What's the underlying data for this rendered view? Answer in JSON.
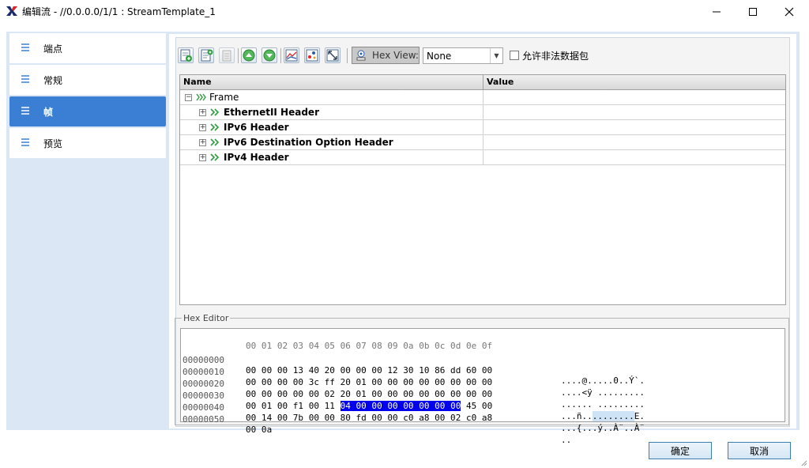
{
  "window": {
    "title": "编辑流 - //0.0.0.0/1/1 : StreamTemplate_1",
    "logo": "x-logo-icon",
    "controls": [
      "minimize-icon",
      "maximize-icon",
      "close-icon"
    ]
  },
  "sidebar": {
    "items": [
      {
        "label": "端点",
        "icon": "list-icon",
        "active": false
      },
      {
        "label": "常规",
        "icon": "list-icon",
        "active": false
      },
      {
        "label": "帧",
        "icon": "list-icon",
        "active": true
      },
      {
        "label": "预览",
        "icon": "list-icon",
        "active": false
      }
    ]
  },
  "toolbar": {
    "icons": [
      "add-doc-icon",
      "insert-doc-icon",
      "paste-doc-icon",
      "move-up-icon",
      "move-down-icon",
      "chart-icon",
      "dots-icon",
      "resize-icon"
    ],
    "hex_view_label": "Hex View:",
    "hex_view_value": "None",
    "allow_illegal_label": "允许非法数据包",
    "allow_illegal_checked": false
  },
  "tree": {
    "headers": {
      "name": "Name",
      "value": "Value"
    },
    "rows": [
      {
        "label": "Frame",
        "value": "",
        "bold": false,
        "expander": "−"
      },
      {
        "label": "EthernetII Header",
        "value": "",
        "bold": true,
        "expander": "+"
      },
      {
        "label": "IPv6 Header",
        "value": "",
        "bold": true,
        "expander": "+"
      },
      {
        "label": "IPv6 Destination Option Header",
        "value": "",
        "bold": true,
        "expander": "+"
      },
      {
        "label": "IPv4 Header",
        "value": "",
        "bold": true,
        "expander": "+"
      }
    ]
  },
  "hex_editor": {
    "title": "Hex Editor",
    "header": "00 01 02 03 04 05 06 07 08 09 0a 0b 0c 0d 0e 0f",
    "lines": [
      {
        "addr": "00000000",
        "pre": "00 00 00 13 40 20 00 00 00 12 30 10 86 dd 60 00",
        "sel": "",
        "post": "",
        "ascii_pre": "....@.....0..Ý`.",
        "ascii_sel": "",
        "ascii_post": ""
      },
      {
        "addr": "00000010",
        "pre": "00 00 00 00 3c ff 20 01 00 00 00 00 00 00 00 00",
        "sel": "",
        "post": "",
        "ascii_pre": "....<ÿ .........",
        "ascii_sel": "",
        "ascii_post": ""
      },
      {
        "addr": "00000020",
        "pre": "00 00 00 00 00 02 20 01 00 00 00 00 00 00 00 00",
        "sel": "",
        "post": "",
        "ascii_pre": "...... .........",
        "ascii_sel": "",
        "ascii_post": ""
      },
      {
        "addr": "00000030",
        "pre": "00 01 00 f1 00 11 ",
        "sel": "04 00 00 00 00 00 00 00",
        "post": " 45 00",
        "ascii_pre": "...ñ..",
        "ascii_sel": "........",
        "ascii_post": "E."
      },
      {
        "addr": "00000040",
        "pre": "00 14 00 7b 00 00 80 fd 00 00 c0 a8 00 02 c0 a8",
        "sel": "",
        "post": "",
        "ascii_pre": "...{...ý..À¨..À¨",
        "ascii_sel": "",
        "ascii_post": ""
      },
      {
        "addr": "00000050",
        "pre": "00 0a",
        "sel": "",
        "post": "",
        "ascii_pre": "..",
        "ascii_sel": "",
        "ascii_post": ""
      }
    ]
  },
  "buttons": {
    "ok": "确定",
    "cancel": "取消"
  },
  "colors": {
    "accent": "#3a7fd4",
    "selection": "#0000ee",
    "chevron": "#2e9e3e",
    "panel_bg": "#dbe7f4"
  }
}
